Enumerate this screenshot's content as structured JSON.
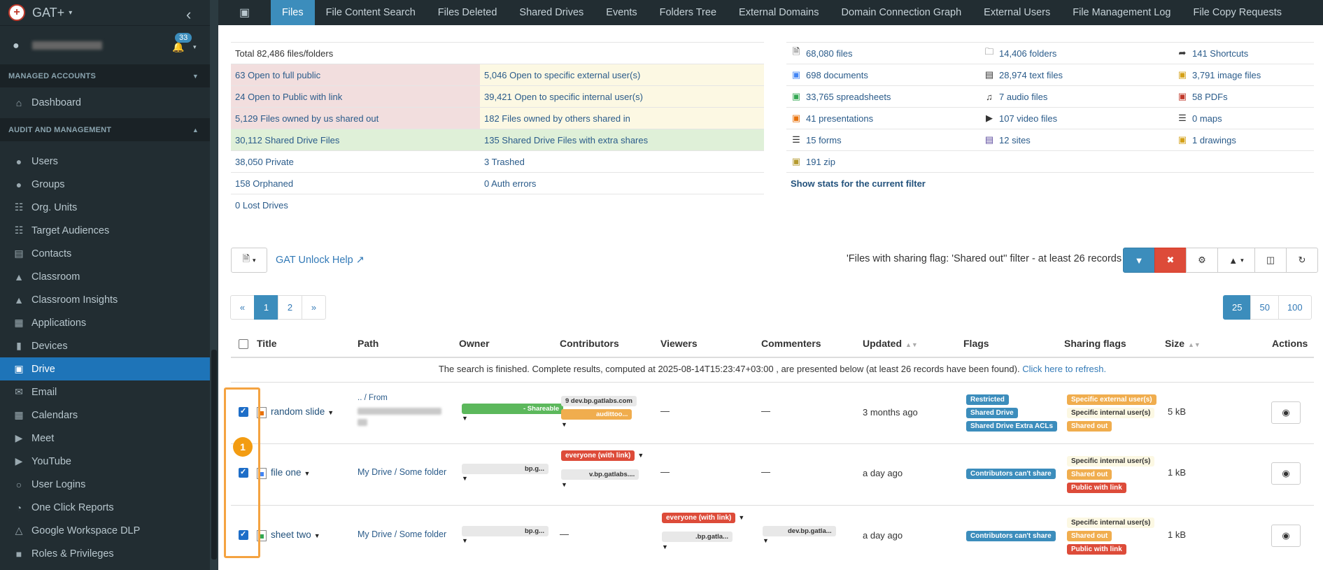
{
  "app": {
    "name": "GAT+",
    "notification_count": "33"
  },
  "sidebar": {
    "section_managed": "MANAGED ACCOUNTS",
    "dashboard": "Dashboard",
    "section_audit": "AUDIT AND MANAGEMENT",
    "items": [
      {
        "label": "Users",
        "icon": "user-icon"
      },
      {
        "label": "Groups",
        "icon": "users-icon"
      },
      {
        "label": "Org. Units",
        "icon": "sitemap-icon"
      },
      {
        "label": "Target Audiences",
        "icon": "sitemap-icon"
      },
      {
        "label": "Contacts",
        "icon": "contact-card-icon"
      },
      {
        "label": "Classroom",
        "icon": "graduation-cap-icon"
      },
      {
        "label": "Classroom Insights",
        "icon": "graduation-cap-icon"
      },
      {
        "label": "Applications",
        "icon": "grid-icon"
      },
      {
        "label": "Devices",
        "icon": "tablet-icon"
      },
      {
        "label": "Drive",
        "icon": "hard-drive-icon"
      },
      {
        "label": "Email",
        "icon": "envelope-icon"
      },
      {
        "label": "Calendars",
        "icon": "calendar-icon"
      },
      {
        "label": "Meet",
        "icon": "video-icon"
      },
      {
        "label": "YouTube",
        "icon": "youtube-icon"
      },
      {
        "label": "User Logins",
        "icon": "globe-icon"
      },
      {
        "label": "One Click Reports",
        "icon": "pie-chart-icon"
      },
      {
        "label": "Google Workspace DLP",
        "icon": "flask-icon"
      },
      {
        "label": "Roles & Privileges",
        "icon": "lock-icon"
      }
    ],
    "active_item": "Drive"
  },
  "topnav": {
    "tabs": [
      "Files",
      "File Content Search",
      "Files Deleted",
      "Shared Drives",
      "Events",
      "Folders Tree",
      "External Domains",
      "Domain Connection Graph",
      "External Users",
      "File Management Log",
      "File Copy Requests"
    ],
    "active": "Files"
  },
  "stats": {
    "total": "Total 82,486 files/folders",
    "rows": [
      [
        "63 Open to full public",
        "5,046 Open to specific external user(s)"
      ],
      [
        "24 Open to Public with link",
        "39,421 Open to specific internal user(s)"
      ],
      [
        "5,129 Files owned by us shared out",
        "182 Files owned by others shared in"
      ],
      [
        "30,112 Shared Drive Files",
        "135 Shared Drive Files with extra shares"
      ],
      [
        "38,050 Private",
        "3 Trashed"
      ],
      [
        "158 Orphaned",
        "0 Auth errors"
      ],
      [
        "0 Lost Drives",
        ""
      ]
    ],
    "types": [
      [
        "68,080 files",
        "14,406 folders",
        "141 Shortcuts"
      ],
      [
        "698 documents",
        "28,974 text files",
        "3,791 image files"
      ],
      [
        "33,765 spreadsheets",
        "7 audio files",
        "58 PDFs"
      ],
      [
        "41 presentations",
        "107 video files",
        "0 maps"
      ],
      [
        "15 forms",
        "12 sites",
        "1 drawings"
      ],
      [
        "191 zip",
        "",
        ""
      ]
    ],
    "show_stats": "Show stats for the current filter"
  },
  "toolbar": {
    "help_link": "GAT Unlock Help",
    "filter_text": "'Files with sharing flag: 'Shared out'' filter -  at least 26 records"
  },
  "pagination": {
    "prev": "«",
    "pages": [
      "1",
      "2"
    ],
    "next": "»",
    "active": "1"
  },
  "page_sizes": [
    "25",
    "50",
    "100"
  ],
  "table": {
    "headers": {
      "title": "Title",
      "path": "Path",
      "owner": "Owner",
      "contributors": "Contributors",
      "viewers": "Viewers",
      "commenters": "Commenters",
      "updated": "Updated",
      "flags": "Flags",
      "sharing_flags": "Sharing flags",
      "size": "Size",
      "actions": "Actions"
    },
    "search_msg": "The search is finished. Complete results, computed at 2025-08-14T15:23:47+03:00 , are presented below (at least 26 records have been found).",
    "refresh_link": "Click here to refresh.",
    "rows": [
      {
        "title": "random slide",
        "path": ".. / From",
        "owner_tag": "- Shareable",
        "contributor_1": "9 dev.bp.gatlabs.com",
        "contributor_2": "audittoo...",
        "viewers": "—",
        "commenters": "—",
        "updated": "3 months ago",
        "flags": [
          "Restricted",
          "Shared Drive",
          "Shared Drive Extra ACLs"
        ],
        "sharing_flags": [
          "Specific external user(s)",
          "Specific internal user(s)",
          "Shared out"
        ],
        "size": "5 kB"
      },
      {
        "title": "file one",
        "path": "My Drive / Some folder",
        "owner_text": "bp.g...",
        "contributor_1": "everyone (with link)",
        "contributor_2": "v.bp.gatlabs....",
        "viewers": "—",
        "commenters": "—",
        "updated": "a day ago",
        "flags": [
          "Contributors can't share"
        ],
        "sharing_flags": [
          "Specific internal user(s)",
          "Shared out",
          "Public with link"
        ],
        "size": "1 kB"
      },
      {
        "title": "sheet two",
        "path": "My Drive / Some folder",
        "owner_text": "bp.g...",
        "contributors": "—",
        "viewer_1": "everyone (with link)",
        "viewer_2": ".bp.gatla...",
        "commenter": "dev.bp.gatla...",
        "updated": "a day ago",
        "flags": [
          "Contributors can't share"
        ],
        "sharing_flags": [
          "Specific internal user(s)",
          "Shared out",
          "Public with link"
        ],
        "size": "1 kB"
      }
    ]
  },
  "annotation_marker": "1",
  "colors": {
    "sidebar_bg": "#222d32",
    "accent": "#3c8dbc",
    "danger": "#dd4b39",
    "warning": "#f0ad4e",
    "highlight": "#f4a341"
  }
}
